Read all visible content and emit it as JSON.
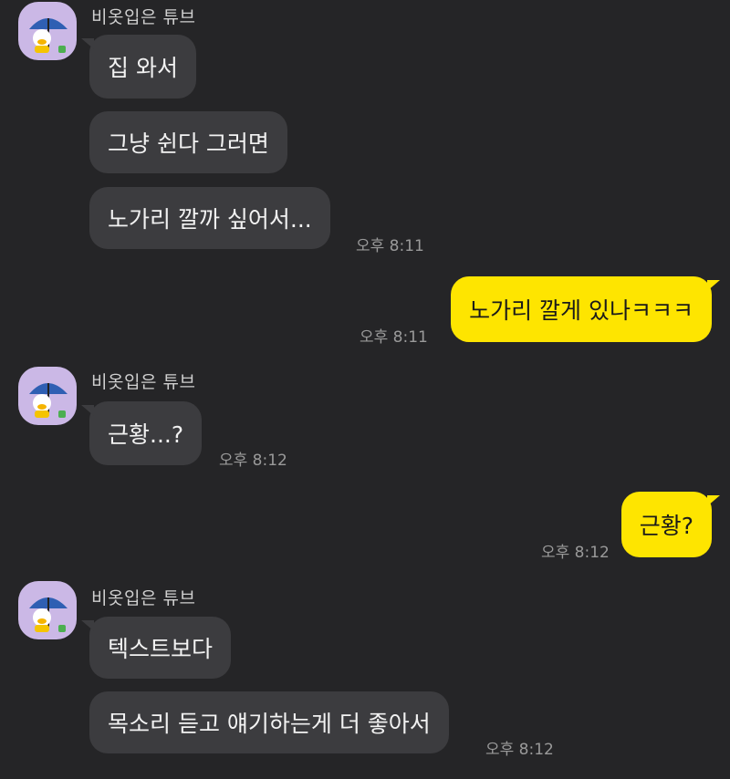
{
  "contact": {
    "name": "비옷입은 튜브",
    "avatar_icon": "tube-duck-umbrella-icon"
  },
  "colors": {
    "background": "#252527",
    "incoming_bubble": "#3c3c3f",
    "outgoing_bubble": "#fee500",
    "avatar_bg": "#cbb8e6"
  },
  "messages": [
    {
      "text": "집 와서"
    },
    {
      "text": "그냥 쉰다 그러면"
    },
    {
      "text": "노가리 깔까 싶어서...",
      "time": "오후 8:11"
    },
    {
      "text": "노가리 깔게 있나ㅋㅋㅋ",
      "time": "오후 8:11"
    },
    {
      "text": "근황...?",
      "time": "오후 8:12"
    },
    {
      "text": "근황?",
      "time": "오후 8:12"
    },
    {
      "text": "텍스트보다"
    },
    {
      "text": "목소리 듣고 얘기하는게 더 좋아서",
      "time": "오후 8:12"
    }
  ]
}
